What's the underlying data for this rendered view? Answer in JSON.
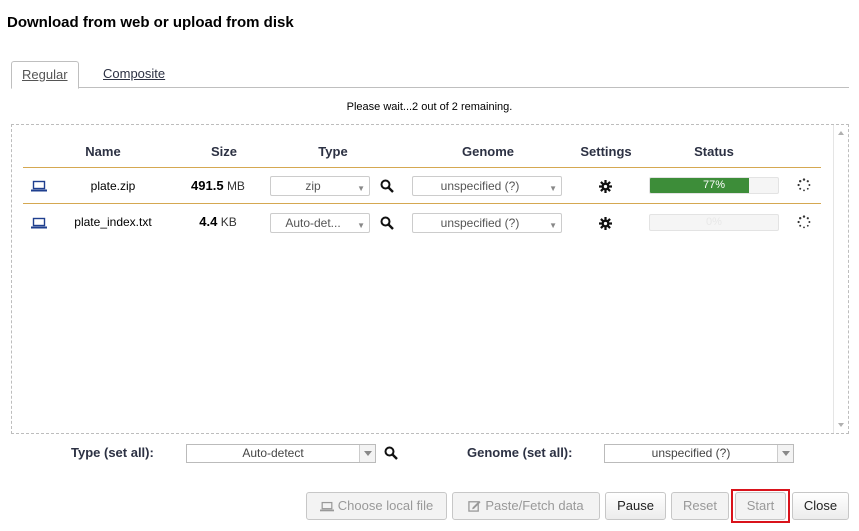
{
  "dialog": {
    "title": "Download from web or upload from disk"
  },
  "tabs": [
    {
      "label": "Regular"
    },
    {
      "label": "Composite"
    }
  ],
  "status_message": "Please wait...2 out of 2 remaining.",
  "table": {
    "headers": {
      "name": "Name",
      "size": "Size",
      "type": "Type",
      "genome": "Genome",
      "settings": "Settings",
      "status": "Status"
    },
    "rows": [
      {
        "name": "plate.zip",
        "size_value": "491.5",
        "size_unit": "MB",
        "type": "zip",
        "genome": "unspecified (?)",
        "progress_text": "77%",
        "progress": 0.77
      },
      {
        "name": "plate_index.txt",
        "size_value": "4.4",
        "size_unit": "KB",
        "type": "Auto-det...",
        "genome": "unspecified (?)",
        "progress_text": "0%",
        "progress": 0
      }
    ]
  },
  "set_all": {
    "type_label": "Type (set all):",
    "type_value": "Auto-detect",
    "genome_label": "Genome (set all):",
    "genome_value": "unspecified (?)"
  },
  "buttons": {
    "choose_local": "Choose local file",
    "paste_fetch": "Paste/Fetch data",
    "pause": "Pause",
    "reset": "Reset",
    "start": "Start",
    "close": "Close"
  },
  "colors": {
    "progress_fill": "#3d8d39",
    "row_border": "#d5a851",
    "highlight": "#d9131b"
  },
  "icons": [
    "laptop-icon",
    "search-icon",
    "gear-icon",
    "spinner-icon",
    "pencil-square-icon",
    "chevron-down-icon"
  ]
}
